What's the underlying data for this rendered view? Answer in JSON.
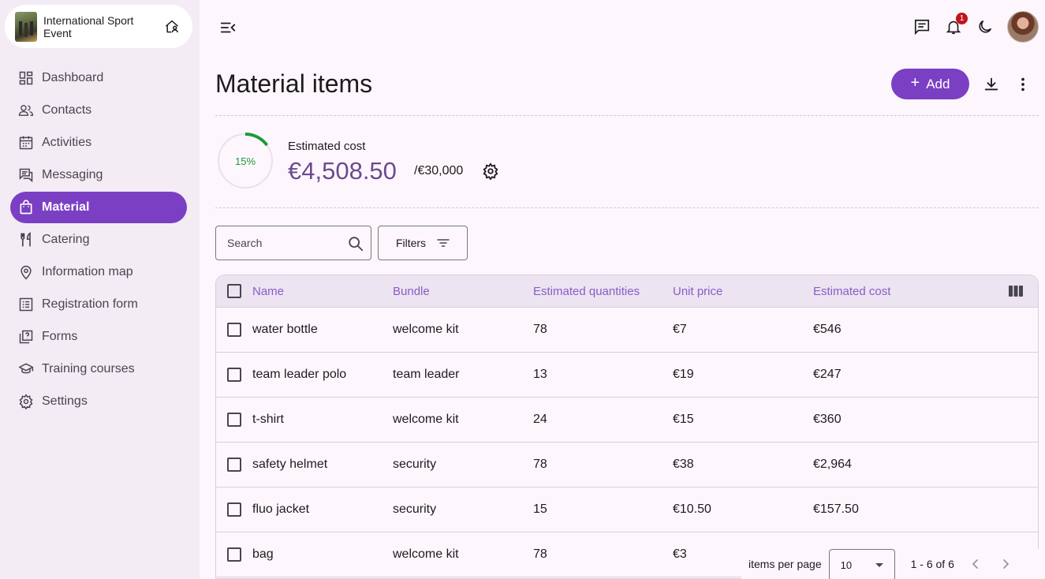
{
  "event": {
    "title": "International Sport Event",
    "home_icon": "home-user-icon"
  },
  "nav": [
    {
      "label": "Dashboard",
      "icon": "dashboard-icon",
      "active": false
    },
    {
      "label": "Contacts",
      "icon": "contacts-icon",
      "active": false
    },
    {
      "label": "Activities",
      "icon": "calendar-icon",
      "active": false
    },
    {
      "label": "Messaging",
      "icon": "messaging-icon",
      "active": false
    },
    {
      "label": "Material",
      "icon": "bag-icon",
      "active": true
    },
    {
      "label": "Catering",
      "icon": "cutlery-icon",
      "active": false
    },
    {
      "label": "Information map",
      "icon": "map-pin-icon",
      "active": false
    },
    {
      "label": "Registration form",
      "icon": "list-icon",
      "active": false
    },
    {
      "label": "Forms",
      "icon": "forms-icon",
      "active": false
    },
    {
      "label": "Training courses",
      "icon": "graduation-cap-icon",
      "active": false
    },
    {
      "label": "Settings",
      "icon": "gear-icon",
      "active": false
    }
  ],
  "topbar": {
    "notifications_count": "1"
  },
  "header": {
    "title": "Material items",
    "add_label": "Add"
  },
  "cost": {
    "percent_label": "15%",
    "percent_value": 0.15,
    "label": "Estimated cost",
    "value": "€4,508.50",
    "budget": "/€30,000"
  },
  "search": {
    "placeholder": "Search"
  },
  "filters": {
    "label": "Filters"
  },
  "table": {
    "columns": [
      "Name",
      "Bundle",
      "Estimated quantities",
      "Unit price",
      "Estimated cost"
    ],
    "rows": [
      {
        "name": "water bottle",
        "bundle": "welcome kit",
        "qty": "78",
        "unit": "€7",
        "cost": "€546"
      },
      {
        "name": "team leader polo",
        "bundle": "team leader",
        "qty": "13",
        "unit": "€19",
        "cost": "€247"
      },
      {
        "name": "t-shirt",
        "bundle": "welcome kit",
        "qty": "24",
        "unit": "€15",
        "cost": "€360"
      },
      {
        "name": "safety helmet",
        "bundle": "security",
        "qty": "78",
        "unit": "€38",
        "cost": "€2,964"
      },
      {
        "name": "fluo jacket",
        "bundle": "security",
        "qty": "15",
        "unit": "€10.50",
        "cost": "€157.50"
      },
      {
        "name": "bag",
        "bundle": "welcome kit",
        "qty": "78",
        "unit": "€3",
        "cost": ""
      }
    ]
  },
  "pager": {
    "label": "items per page",
    "per_page": "10",
    "range": "1 - 6 of 6"
  },
  "colors": {
    "accent": "#7b3fc4",
    "progress": "#1f9a3a",
    "cost_value": "#6b4a90"
  }
}
